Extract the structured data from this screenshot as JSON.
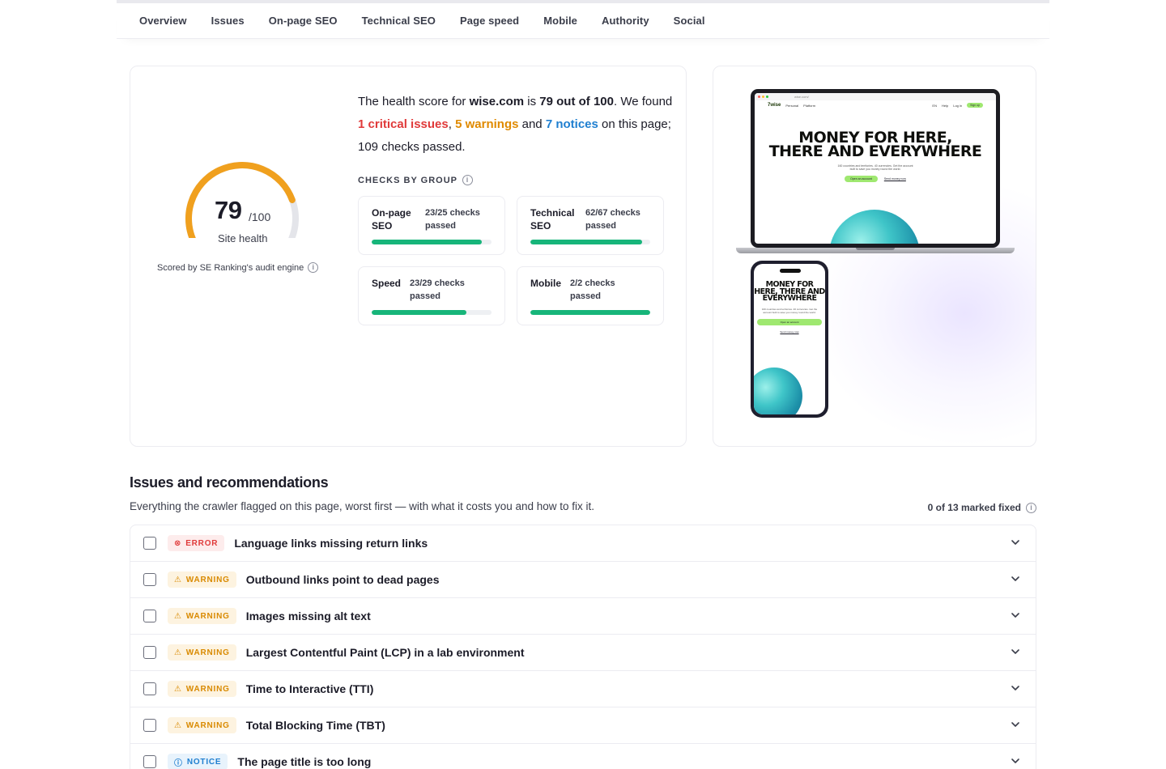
{
  "nav": {
    "items": [
      "Overview",
      "Issues",
      "On-page SEO",
      "Technical SEO",
      "Page speed",
      "Mobile",
      "Authority",
      "Social"
    ]
  },
  "score": {
    "value": "79",
    "max": "/100",
    "fraction": 0.79,
    "label": "Site health",
    "scored_by": "Scored by SE Ranking's audit engine"
  },
  "summary": {
    "p1": "The health score for ",
    "domain": "wise.com",
    "p2": " is ",
    "score_text": "79 out of 100",
    "p3": ". We found ",
    "critical": "1 critical issues",
    "p4": ", ",
    "warnings": "5 warnings",
    "p5": " and ",
    "notices": "7 notices",
    "p6": " on this page; 109 checks passed."
  },
  "groups": {
    "title": "CHECKS BY GROUP",
    "items": [
      {
        "name": "On-page SEO",
        "checks": "23/25 checks passed",
        "progress": 0.92
      },
      {
        "name": "Technical SEO",
        "checks": "62/67 checks passed",
        "progress": 0.93
      },
      {
        "name": "Speed",
        "checks": "23/29 checks passed",
        "progress": 0.79
      },
      {
        "name": "Mobile",
        "checks": "2/2 checks passed",
        "progress": 1.0
      }
    ]
  },
  "preview": {
    "url": "wise.com/",
    "logo": "7wise",
    "nav_links": [
      "Personal",
      "Platform"
    ],
    "nav_right": [
      "EN",
      "Help",
      "Log in"
    ],
    "signup": "Sign up",
    "hero_line1": "MONEY FOR HERE,",
    "hero_line2": "THERE AND EVERYWHERE",
    "phone_hero_1": "MONEY FOR",
    "phone_hero_2": "HERE, THERE AND",
    "phone_hero_3": "EVERYWHERE",
    "subtext": "160 countries and territories. 40 currencies. Get the account built to save you money round the world.",
    "cta_primary": "Open an account",
    "cta_secondary": "Send money now"
  },
  "issues": {
    "title": "Issues and recommendations",
    "subtitle": "Everything the crawler flagged on this page, worst first — with what it costs you and how to fix it.",
    "marked": "0 of 13 marked fixed",
    "rows": [
      {
        "level": "ERROR",
        "title": "Language links missing return links"
      },
      {
        "level": "WARNING",
        "title": "Outbound links point to dead pages"
      },
      {
        "level": "WARNING",
        "title": "Images missing alt text"
      },
      {
        "level": "WARNING",
        "title": "Largest Contentful Paint (LCP) in a lab environment"
      },
      {
        "level": "WARNING",
        "title": "Time to Interactive (TTI)"
      },
      {
        "level": "WARNING",
        "title": "Total Blocking Time (TBT)"
      },
      {
        "level": "NOTICE",
        "title": "The page title is too long"
      }
    ]
  },
  "colors": {
    "gauge": "#f0a01e",
    "gauge_track": "#e4e5ea",
    "progress": "#17b57a",
    "error": "#e03a3a",
    "warning": "#e08a00",
    "notice": "#1f7fd0"
  }
}
